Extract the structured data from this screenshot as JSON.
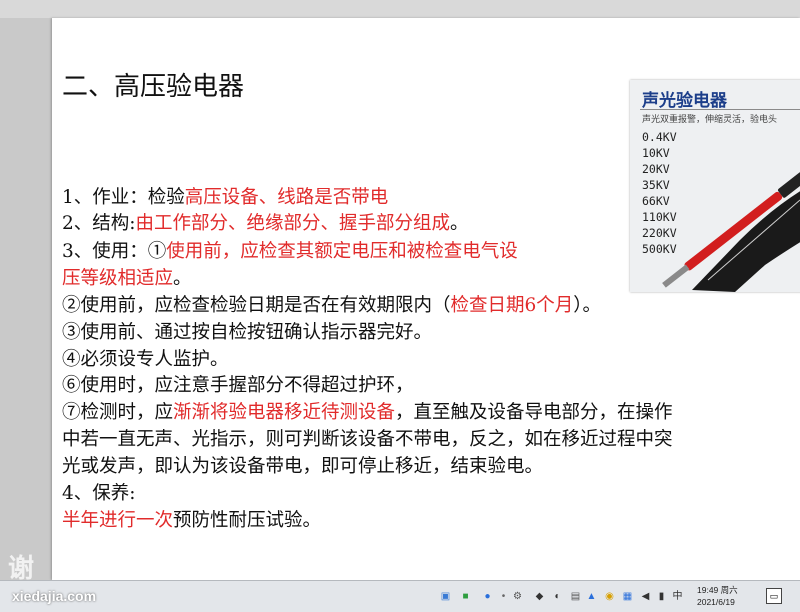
{
  "slide": {
    "title": "二、高压验电器",
    "lines": [
      {
        "segments": [
          {
            "t": "1、作业：检验"
          },
          {
            "t": "高压设备、线路是否带电"
          }
        ]
      },
      {
        "segments": [
          {
            "t": "2、结构:"
          },
          {
            "t": "由工作部分、绝缘部分、握手部分组成"
          },
          {
            "t": "。"
          }
        ]
      },
      {
        "segments": [
          {
            "t": " 3、使用：①"
          },
          {
            "t": "使用前，应检查其额定电压和被检查电气设"
          }
        ]
      },
      {
        "segments": [
          {
            "t": "压等级相适应"
          },
          {
            "t": "。"
          }
        ]
      },
      {
        "segments": [
          {
            "t": "②使用前，应检查检验日期是否在有效期限内（"
          },
          {
            "t": "检查日期6个月"
          },
          {
            "t": "）。"
          }
        ]
      },
      {
        "segments": [
          {
            "t": "③使用前、通过按自检按钮确认指示器完好。"
          }
        ]
      },
      {
        "segments": [
          {
            "t": "④必须设专人监护。"
          }
        ]
      },
      {
        "segments": [
          {
            "t": "⑥使用时，应注意手握部分不得超过护环，"
          }
        ]
      },
      {
        "segments": [
          {
            "t": "⑦检测时，应"
          },
          {
            "t": "渐渐将验电器移近待测设备"
          },
          {
            "t": "，直至触及设备导电部分，在操作"
          }
        ]
      },
      {
        "segments": [
          {
            "t": "中若一直无声、光指示，则可判断该设备不带电，反之，如在移近过程中突"
          }
        ]
      },
      {
        "segments": [
          {
            "t": "光或发声，即认为该设备带电，即可停止移近，结束验电。"
          }
        ]
      },
      {
        "segments": [
          {
            "t": "4、保养:"
          }
        ]
      },
      {
        "segments": [
          {
            "t": "半年进行一次"
          },
          {
            "t": "预防性耐压试验。"
          }
        ]
      }
    ],
    "product": {
      "title": "声光验电器",
      "subtitle": "声光双重报警，伸缩灵活，验电头",
      "voltages": [
        "0.4KV",
        "10KV",
        "20KV",
        "35KV",
        "66KV",
        "110KV",
        "220KV",
        "500KV"
      ]
    }
  },
  "watermark": {
    "text": "谢",
    "site": "xiedajia.com"
  },
  "taskbar": {
    "time": "19:49 周六",
    "date": "2021/6/19"
  },
  "colors": {
    "highlight": "#e12b2b",
    "text": "#111111",
    "taskbar": "#e3e6ea"
  }
}
